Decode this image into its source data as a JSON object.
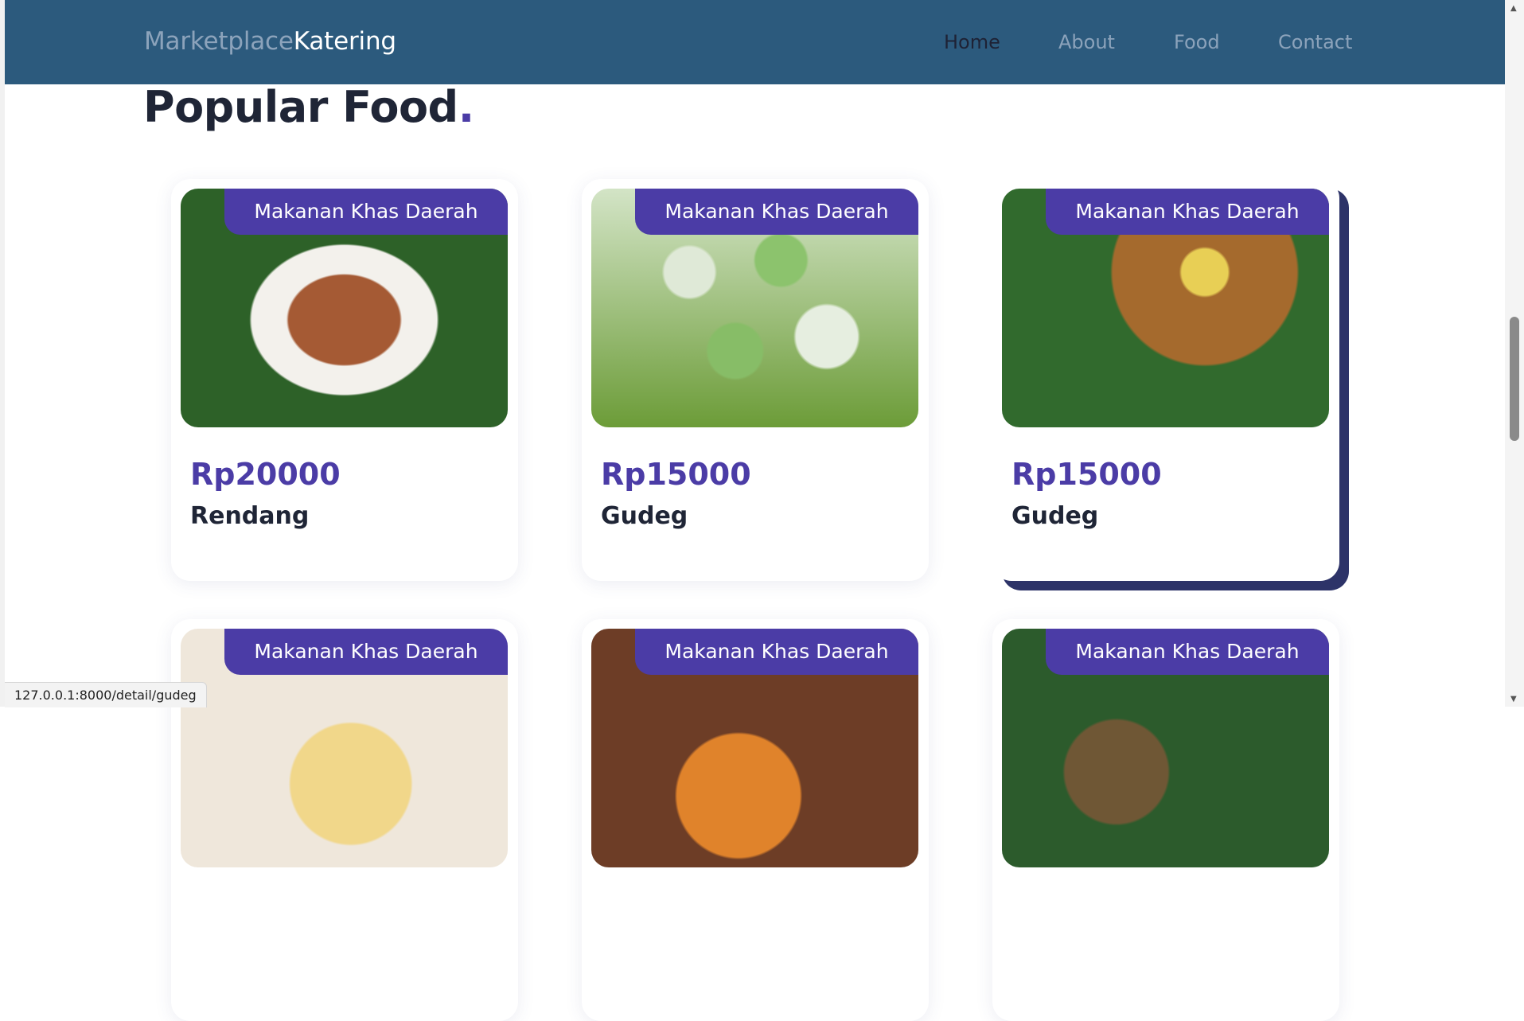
{
  "navbar": {
    "brand_part1": "Marketplace",
    "brand_part2": "Katering",
    "links": [
      "Home",
      "About",
      "Food",
      "Contact"
    ],
    "active_link": "Home"
  },
  "section": {
    "title": "Popular Food",
    "title_dot": "."
  },
  "cards": [
    {
      "badge": "Makanan Khas Daerah",
      "price": "Rp20000",
      "name": "Rendang"
    },
    {
      "badge": "Makanan Khas Daerah",
      "price": "Rp15000",
      "name": "Gudeg"
    },
    {
      "badge": "Makanan Khas Daerah",
      "price": "Rp15000",
      "name": "Gudeg"
    },
    {
      "badge": "Makanan Khas Daerah"
    },
    {
      "badge": "Makanan Khas Daerah"
    },
    {
      "badge": "Makanan Khas Daerah"
    }
  ],
  "status_bar": {
    "url": "127.0.0.1:8000/detail/gudeg"
  },
  "colors": {
    "navbar": "#2c5a7d",
    "accent": "#4b3ca6",
    "hover_shadow": "#2d3368",
    "heading": "#1f2536"
  }
}
